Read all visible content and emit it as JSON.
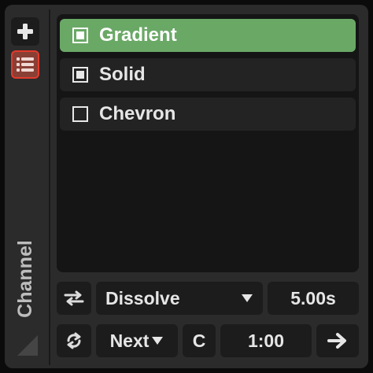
{
  "sidebar": {
    "add_icon": "plus-icon",
    "list_icon": "list-icon",
    "label": "Channel"
  },
  "items": [
    {
      "label": "Gradient",
      "checked": true,
      "selected": true
    },
    {
      "label": "Solid",
      "checked": true,
      "selected": false
    },
    {
      "label": "Chevron",
      "checked": false,
      "selected": false
    }
  ],
  "controls": {
    "transition": "Dissolve",
    "duration": "5.00s",
    "mode": "Next",
    "c_label": "C",
    "time": "1:00"
  },
  "colors": {
    "selected_row": "#6aa866",
    "active_button": "#8a3f35",
    "active_border": "#e33a2c"
  }
}
